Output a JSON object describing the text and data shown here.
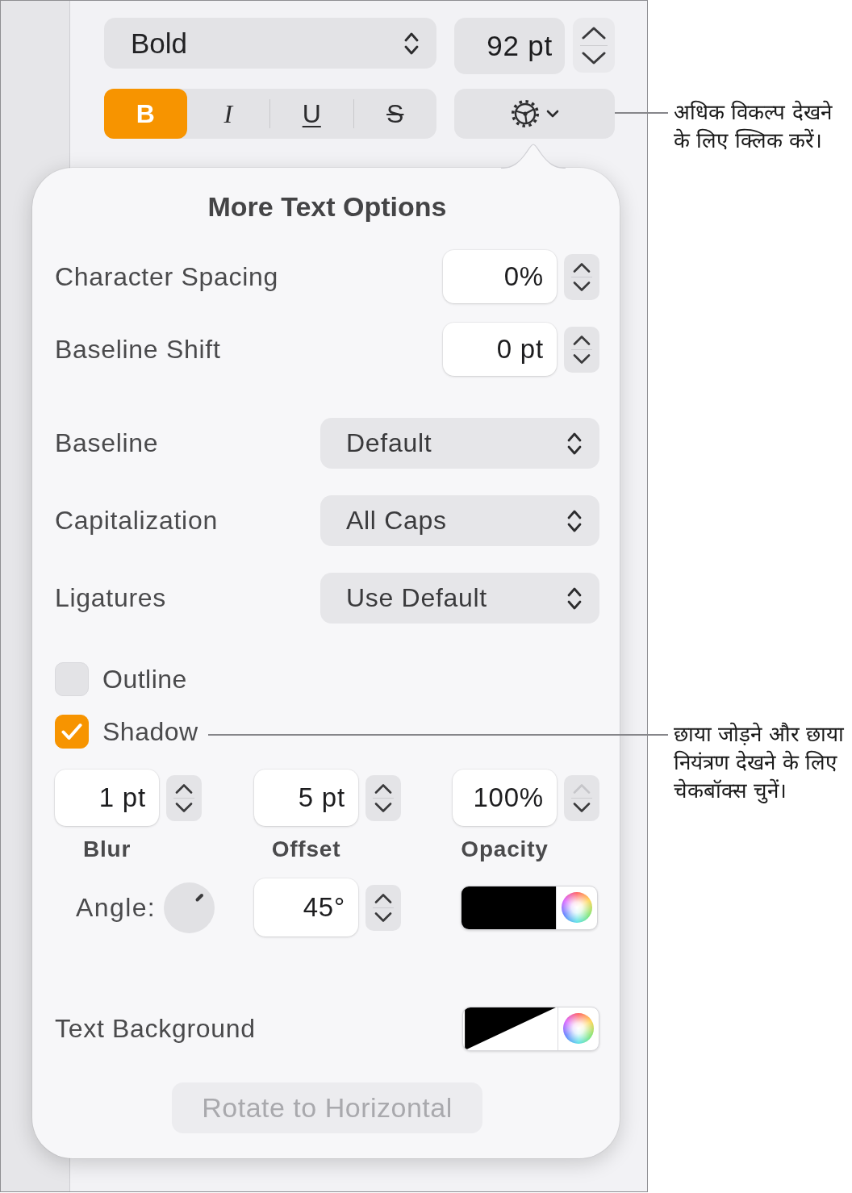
{
  "toolbar": {
    "font_style": "Bold",
    "font_size": "92 pt",
    "style_buttons": [
      {
        "kind": "bold",
        "label": "B",
        "selected": true
      },
      {
        "kind": "italic",
        "label": "I",
        "selected": false
      },
      {
        "kind": "underline",
        "label": "U",
        "selected": false
      },
      {
        "kind": "strikethrough",
        "label": "S",
        "selected": false
      }
    ]
  },
  "popover": {
    "title": "More Text Options",
    "rows": [
      {
        "kind": "stepper",
        "label": "Character Spacing",
        "value": "0%"
      },
      {
        "kind": "stepper",
        "label": "Baseline Shift",
        "value": "0 pt"
      },
      {
        "kind": "popup",
        "label": "Baseline",
        "value": "Default"
      },
      {
        "kind": "popup",
        "label": "Capitalization",
        "value": "All Caps"
      },
      {
        "kind": "popup",
        "label": "Ligatures",
        "value": "Use Default"
      }
    ],
    "checkboxes": [
      {
        "label": "Outline",
        "checked": false
      },
      {
        "label": "Shadow",
        "checked": true
      }
    ],
    "shadow": {
      "fields": [
        {
          "label": "Blur",
          "value": "1 pt",
          "up_disabled": false
        },
        {
          "label": "Offset",
          "value": "5 pt",
          "up_disabled": false
        },
        {
          "label": "Opacity",
          "value": "100%",
          "up_disabled": true
        }
      ],
      "angle": {
        "label": "Angle:",
        "value": "45°"
      },
      "color_well": {
        "kind": "solid"
      }
    },
    "text_background": {
      "label": "Text Background",
      "color_well": {
        "kind": "partial"
      }
    },
    "rotate_button": {
      "label": "Rotate to Horizontal",
      "disabled": true
    }
  },
  "callouts": [
    {
      "text": "अधिक विकल्प देखने के लिए क्लिक करें।"
    },
    {
      "text": "छाया जोड़ने और छाया नियंत्रण देखने के लिए चेकबॉक्स चुनें।"
    }
  ]
}
